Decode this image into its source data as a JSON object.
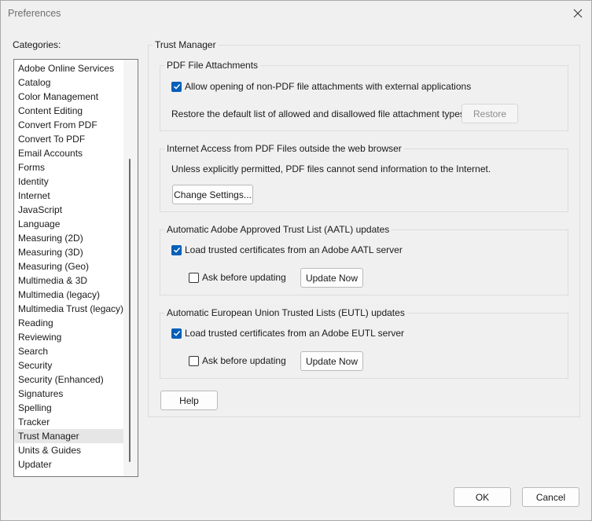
{
  "window": {
    "title": "Preferences"
  },
  "categories": {
    "label": "Categories:",
    "items": [
      "Adobe Online Services",
      "Catalog",
      "Color Management",
      "Content Editing",
      "Convert From PDF",
      "Convert To PDF",
      "Email Accounts",
      "Forms",
      "Identity",
      "Internet",
      "JavaScript",
      "Language",
      "Measuring (2D)",
      "Measuring (3D)",
      "Measuring (Geo)",
      "Multimedia & 3D",
      "Multimedia (legacy)",
      "Multimedia Trust (legacy)",
      "Reading",
      "Reviewing",
      "Search",
      "Security",
      "Security (Enhanced)",
      "Signatures",
      "Spelling",
      "Tracker",
      "Trust Manager",
      "Units & Guides",
      "Updater"
    ],
    "selected": "Trust Manager"
  },
  "panel": {
    "title": "Trust Manager",
    "attachments": {
      "title": "PDF File Attachments",
      "allow_label": "Allow opening of non-PDF file attachments with external applications",
      "allow_checked": true,
      "restore_text": "Restore the default list of allowed and disallowed file attachment types:",
      "restore_button": "Restore"
    },
    "internet": {
      "title": "Internet Access from PDF Files outside the web browser",
      "text": "Unless explicitly permitted, PDF files cannot send information to the Internet.",
      "change_button": "Change Settings..."
    },
    "aatl": {
      "title": "Automatic Adobe Approved Trust List (AATL) updates",
      "load_label": "Load trusted certificates from an Adobe AATL server",
      "load_checked": true,
      "ask_label": "Ask before updating",
      "ask_checked": false,
      "update_button": "Update Now"
    },
    "eutl": {
      "title": "Automatic European Union Trusted Lists (EUTL) updates",
      "load_label": "Load trusted certificates from an Adobe EUTL server",
      "load_checked": true,
      "ask_label": "Ask before updating",
      "ask_checked": false,
      "update_button": "Update Now"
    },
    "help_button": "Help"
  },
  "footer": {
    "ok": "OK",
    "cancel": "Cancel"
  },
  "colors": {
    "checkbox_accent": "#005fb8",
    "selected_item": "#e6e6e6"
  }
}
